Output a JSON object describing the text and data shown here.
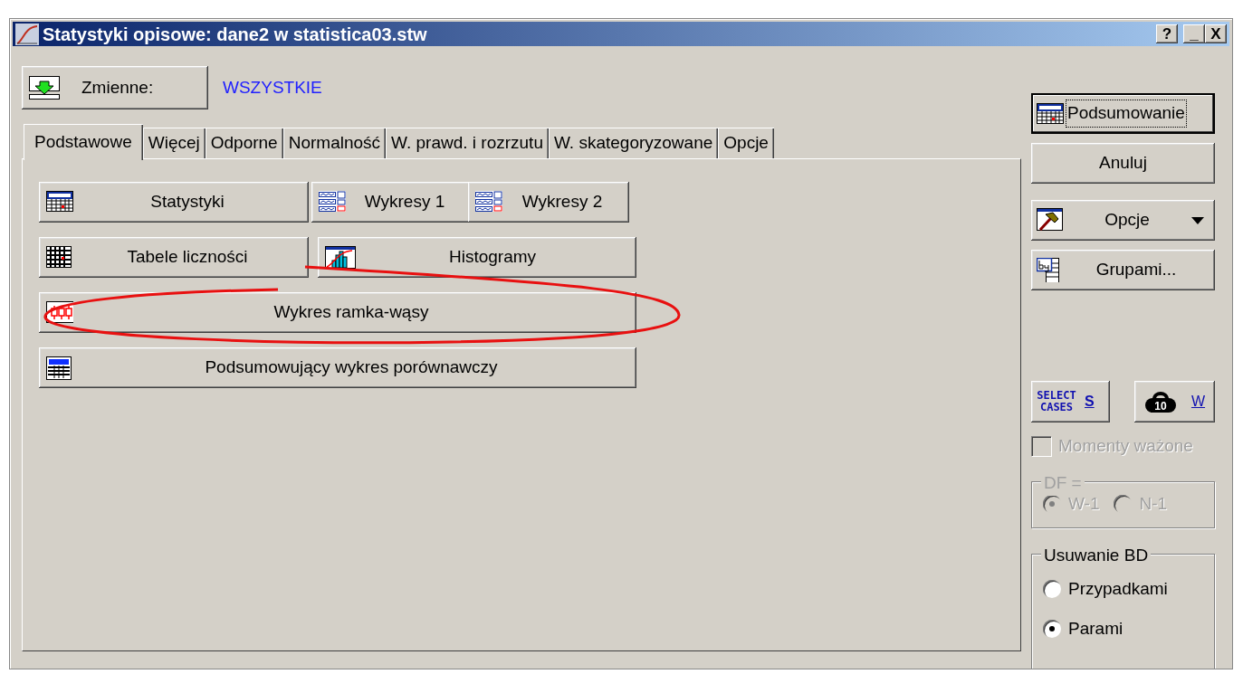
{
  "window": {
    "title": "Statystyki opisowe: dane2 w statistica03.stw",
    "controls": [
      {
        "kind": "help",
        "label": "?"
      },
      {
        "kind": "minimize",
        "label": "_"
      },
      {
        "kind": "close",
        "label": "X"
      }
    ]
  },
  "variables": {
    "button": "Zmienne:",
    "value": "WSZYSTKIE"
  },
  "tabs": [
    {
      "label": "Podstawowe",
      "selected": true
    },
    {
      "label": "Więcej",
      "selected": false
    },
    {
      "label": "Odporne",
      "selected": false
    },
    {
      "label": "Normalność",
      "selected": false
    },
    {
      "label": "W. prawd. i rozrzutu",
      "selected": false
    },
    {
      "label": "W. skategoryzowane",
      "selected": false
    },
    {
      "label": "Opcje",
      "selected": false
    }
  ],
  "panel_rows": [
    [
      {
        "label": "Statystyki",
        "kind": "summ"
      },
      {
        "label": "Wykresy 1",
        "kind": "plots"
      },
      {
        "label": "Wykresy 2",
        "kind": "plots"
      }
    ],
    [
      {
        "label": "Tabele liczności",
        "kind": "grid"
      },
      {
        "label": "Histogramy",
        "kind": "histogram"
      }
    ],
    [
      {
        "label": "Wykres ramka-wąsy",
        "kind": "boxplot"
      }
    ],
    [
      {
        "label": "Podsumowujący wykres porównawczy",
        "kind": "table"
      }
    ]
  ],
  "side_buttons": [
    {
      "label": "Podsumowanie",
      "kind": "default"
    },
    {
      "label": "Anuluj",
      "kind": "plain"
    },
    {
      "label": "Opcje",
      "kind": "dropdown"
    },
    {
      "label": "Grupami...",
      "kind": "plain"
    }
  ],
  "select_cases": {
    "icon_text": "SELECT CASES",
    "key": "S"
  },
  "weight": {
    "icon_text": "10",
    "key": "W"
  },
  "weighted_moments": {
    "label": "Momenty ważone",
    "checked": false,
    "disabled": true
  },
  "df_group": {
    "title": "DF =",
    "disabled": true,
    "options": [
      {
        "label": "W-1",
        "selected": true
      },
      {
        "label": "N-1",
        "selected": false
      }
    ]
  },
  "missing_data": {
    "title": "Usuwanie BD",
    "disabled": false,
    "options": [
      {
        "label": "Przypadkami",
        "selected": false
      },
      {
        "label": "Parami",
        "selected": true
      }
    ]
  },
  "annotation": {
    "kind": "ellipse"
  }
}
